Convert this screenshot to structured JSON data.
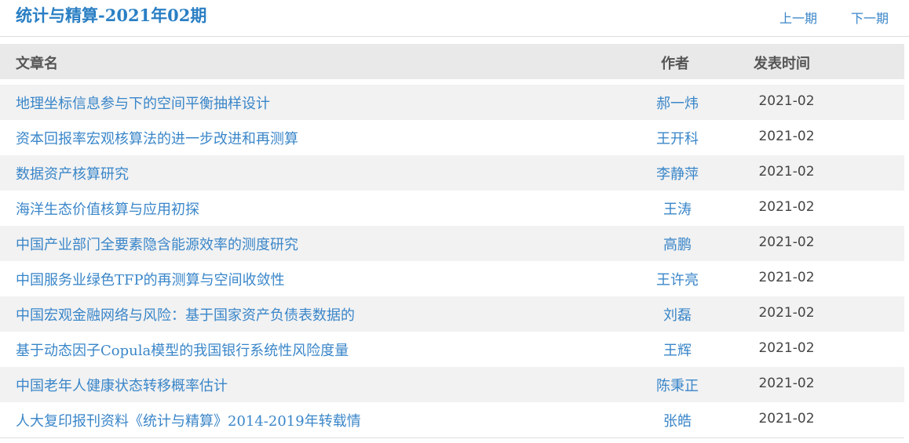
{
  "header": {
    "title": "统计与精算-2021年02期",
    "prev_label": "上一期",
    "next_label": "下一期"
  },
  "table": {
    "columns": {
      "title": "文章名",
      "author": "作者",
      "date": "发表时间"
    },
    "rows": [
      {
        "title": "地理坐标信息参与下的空间平衡抽样设计",
        "author": "郝一炜",
        "date": "2021-02"
      },
      {
        "title": "资本回报率宏观核算法的进一步改进和再测算",
        "author": "王开科",
        "date": "2021-02"
      },
      {
        "title": "数据资产核算研究",
        "author": "李静萍",
        "date": "2021-02"
      },
      {
        "title": "海洋生态价值核算与应用初探",
        "author": "王涛",
        "date": "2021-02"
      },
      {
        "title": "中国产业部门全要素隐含能源效率的测度研究",
        "author": "高鹏",
        "date": "2021-02"
      },
      {
        "title": "中国服务业绿色TFP的再测算与空间收敛性",
        "author": "王许亮",
        "date": "2021-02"
      },
      {
        "title": "中国宏观金融网络与风险：基于国家资产负债表数据的",
        "author": "刘磊",
        "date": "2021-02"
      },
      {
        "title": "基于动态因子Copula模型的我国银行系统性风险度量",
        "author": "王辉",
        "date": "2021-02"
      },
      {
        "title": "中国老年人健康状态转移概率估计",
        "author": "陈秉正",
        "date": "2021-02"
      },
      {
        "title": "人大复印报刊资料《统计与精算》2014-2019年转载情",
        "author": "张皓",
        "date": "2021-02"
      }
    ]
  }
}
